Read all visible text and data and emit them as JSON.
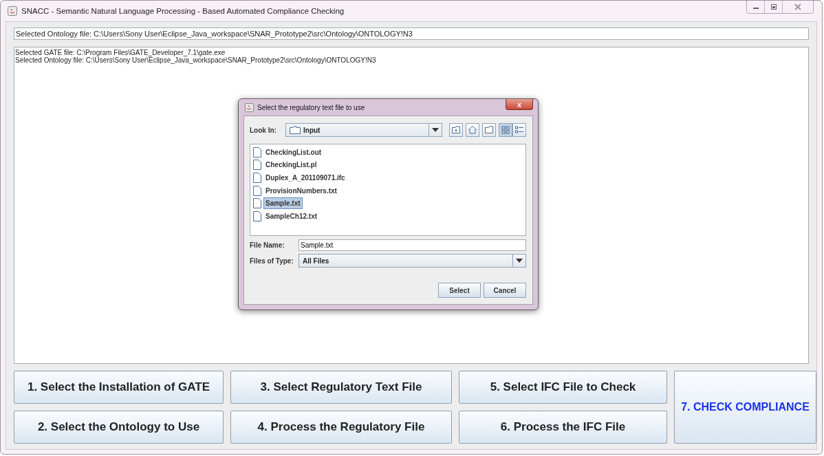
{
  "window": {
    "title": "SNACC - Semantic Natural Language Processing - Based Automated Compliance Checking"
  },
  "status_field": {
    "value": "Selected Ontology file: C:\\Users\\Sony User\\Eclipse_Java_workspace\\SNAR_Prototype2\\src\\Ontology\\ONTOLOGY!N3"
  },
  "log": [
    "Selected GATE file: C:\\Program Files\\GATE_Developer_7.1\\gate.exe",
    "Selected Ontology file: C:\\Users\\Sony User\\Eclipse_Java_workspace\\SNAR_Prototype2\\src\\Ontology\\ONTOLOGY!N3"
  ],
  "buttons": [
    {
      "label": "1. Select the Installation of GATE",
      "kind": "step"
    },
    {
      "label": "3. Select Regulatory Text File",
      "kind": "step"
    },
    {
      "label": "5. Select IFC File to Check",
      "kind": "step"
    },
    {
      "label": "7. CHECK COMPLIANCE",
      "kind": "primary"
    },
    {
      "label": "2. Select the Ontology to Use",
      "kind": "step"
    },
    {
      "label": "4. Process the Regulatory File",
      "kind": "step"
    },
    {
      "label": "6. Process the IFC File",
      "kind": "step"
    }
  ],
  "dialog": {
    "title": "Select the regulatory text file to use",
    "close": "x",
    "look_in_label": "Look In:",
    "look_in_value": "Input",
    "files": [
      {
        "name": "CheckingList.out",
        "selected": false
      },
      {
        "name": "CheckingList.pl",
        "selected": false
      },
      {
        "name": "Duplex_A_201109071.ifc",
        "selected": false
      },
      {
        "name": "ProvisionNumbers.txt",
        "selected": false
      },
      {
        "name": "Sample.txt",
        "selected": true
      },
      {
        "name": "SampleCh12.txt",
        "selected": false
      }
    ],
    "file_name_label": "File Name:",
    "file_name": "Sample.txt",
    "file_type_label": "Files of Type:",
    "file_type": "All Files",
    "buttons": [
      "Select",
      "Cancel"
    ]
  }
}
